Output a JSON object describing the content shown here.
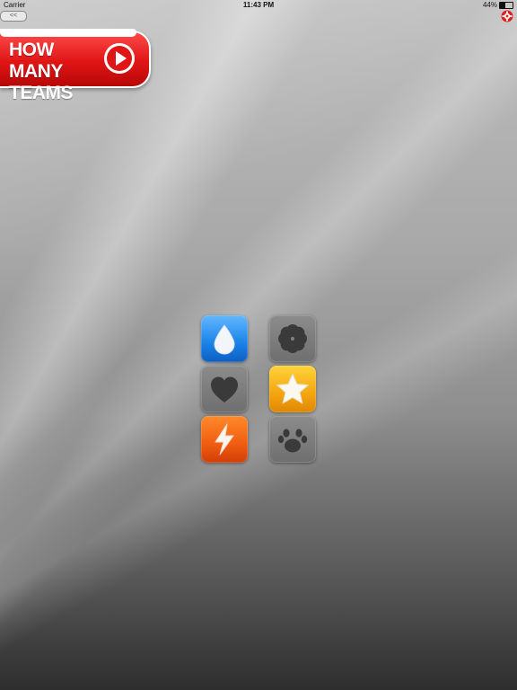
{
  "status_bar": {
    "carrier": "Carrier",
    "time": "11:43 PM",
    "battery": "44%"
  },
  "back_button": {
    "label": "<<"
  },
  "banner": {
    "text": "HOW MANY TEAMS"
  },
  "tiles": [
    {
      "team": "water",
      "icon": "water-drop-icon",
      "state": "active",
      "color": "#1b82e8"
    },
    {
      "team": "flower",
      "icon": "flower-icon",
      "state": "inactive",
      "color": "#7a7a7a"
    },
    {
      "team": "heart",
      "icon": "heart-icon",
      "state": "inactive",
      "color": "#7a7a7a"
    },
    {
      "team": "star",
      "icon": "star-icon",
      "state": "active",
      "color": "#f3a60e"
    },
    {
      "team": "lightning",
      "icon": "lightning-icon",
      "state": "active",
      "color": "#f05d11"
    },
    {
      "team": "paw",
      "icon": "paw-icon",
      "state": "inactive",
      "color": "#7a7a7a"
    }
  ],
  "colors": {
    "banner_red": "#e01515",
    "settings_red": "#e02020"
  }
}
